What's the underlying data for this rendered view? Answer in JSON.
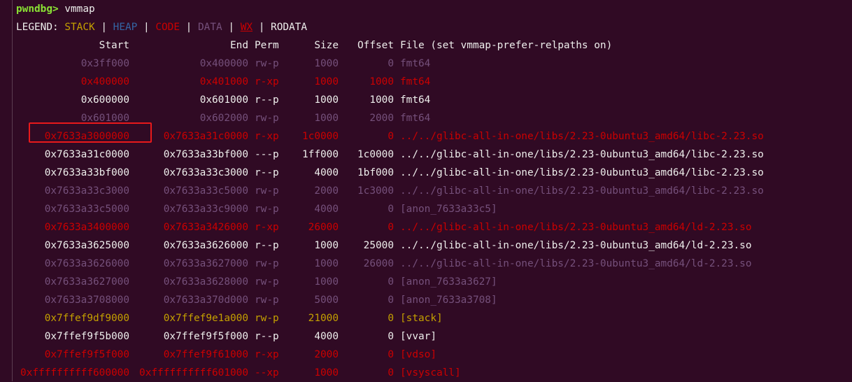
{
  "prompt": {
    "name": "pwndbg>",
    "command": "vmmap"
  },
  "legend": {
    "label": "LEGEND:",
    "separator": "|",
    "items": [
      {
        "text": "STACK",
        "kind": "stack"
      },
      {
        "text": "HEAP",
        "kind": "heap"
      },
      {
        "text": "CODE",
        "kind": "code"
      },
      {
        "text": "DATA",
        "kind": "data"
      },
      {
        "text": "WX",
        "kind": "wx"
      },
      {
        "text": "RODATA",
        "kind": "rodata"
      }
    ]
  },
  "table": {
    "headers": [
      "Start",
      "End",
      "Perm",
      "Size",
      "Offset",
      "File (set vmmap-prefer-relpaths on)"
    ],
    "rows": [
      {
        "start": "0x3ff000",
        "end": "0x400000",
        "perm": "rw-p",
        "size": "1000",
        "offset": "0",
        "file": "fmt64",
        "kind": "data"
      },
      {
        "start": "0x400000",
        "end": "0x401000",
        "perm": "r-xp",
        "size": "1000",
        "offset": "1000",
        "file": "fmt64",
        "kind": "code"
      },
      {
        "start": "0x600000",
        "end": "0x601000",
        "perm": "r--p",
        "size": "1000",
        "offset": "1000",
        "file": "fmt64",
        "kind": "rodata"
      },
      {
        "start": "0x601000",
        "end": "0x602000",
        "perm": "rw-p",
        "size": "1000",
        "offset": "2000",
        "file": "fmt64",
        "kind": "data"
      },
      {
        "start": "0x7633a3000000",
        "end": "0x7633a31c0000",
        "perm": "r-xp",
        "size": "1c0000",
        "offset": "0",
        "file": "../../glibc-all-in-one/libs/2.23-0ubuntu3_amd64/libc-2.23.so",
        "kind": "code"
      },
      {
        "start": "0x7633a31c0000",
        "end": "0x7633a33bf000",
        "perm": "---p",
        "size": "1ff000",
        "offset": "1c0000",
        "file": "../../glibc-all-in-one/libs/2.23-0ubuntu3_amd64/libc-2.23.so",
        "kind": "rodata"
      },
      {
        "start": "0x7633a33bf000",
        "end": "0x7633a33c3000",
        "perm": "r--p",
        "size": "4000",
        "offset": "1bf000",
        "file": "../../glibc-all-in-one/libs/2.23-0ubuntu3_amd64/libc-2.23.so",
        "kind": "rodata"
      },
      {
        "start": "0x7633a33c3000",
        "end": "0x7633a33c5000",
        "perm": "rw-p",
        "size": "2000",
        "offset": "1c3000",
        "file": "../../glibc-all-in-one/libs/2.23-0ubuntu3_amd64/libc-2.23.so",
        "kind": "data"
      },
      {
        "start": "0x7633a33c5000",
        "end": "0x7633a33c9000",
        "perm": "rw-p",
        "size": "4000",
        "offset": "0",
        "file": "[anon_7633a33c5]",
        "kind": "data"
      },
      {
        "start": "0x7633a3400000",
        "end": "0x7633a3426000",
        "perm": "r-xp",
        "size": "26000",
        "offset": "0",
        "file": "../../glibc-all-in-one/libs/2.23-0ubuntu3_amd64/ld-2.23.so",
        "kind": "code"
      },
      {
        "start": "0x7633a3625000",
        "end": "0x7633a3626000",
        "perm": "r--p",
        "size": "1000",
        "offset": "25000",
        "file": "../../glibc-all-in-one/libs/2.23-0ubuntu3_amd64/ld-2.23.so",
        "kind": "rodata"
      },
      {
        "start": "0x7633a3626000",
        "end": "0x7633a3627000",
        "perm": "rw-p",
        "size": "1000",
        "offset": "26000",
        "file": "../../glibc-all-in-one/libs/2.23-0ubuntu3_amd64/ld-2.23.so",
        "kind": "data"
      },
      {
        "start": "0x7633a3627000",
        "end": "0x7633a3628000",
        "perm": "rw-p",
        "size": "1000",
        "offset": "0",
        "file": "[anon_7633a3627]",
        "kind": "data"
      },
      {
        "start": "0x7633a3708000",
        "end": "0x7633a370d000",
        "perm": "rw-p",
        "size": "5000",
        "offset": "0",
        "file": "[anon_7633a3708]",
        "kind": "data"
      },
      {
        "start": "0x7ffef9df9000",
        "end": "0x7ffef9e1a000",
        "perm": "rw-p",
        "size": "21000",
        "offset": "0",
        "file": "[stack]",
        "kind": "stack"
      },
      {
        "start": "0x7ffef9f5b000",
        "end": "0x7ffef9f5f000",
        "perm": "r--p",
        "size": "4000",
        "offset": "0",
        "file": "[vvar]",
        "kind": "rodata"
      },
      {
        "start": "0x7ffef9f5f000",
        "end": "0x7ffef9f61000",
        "perm": "r-xp",
        "size": "2000",
        "offset": "0",
        "file": "[vdso]",
        "kind": "code"
      },
      {
        "start": "0xffffffffff600000",
        "end": "0xffffffffff601000",
        "perm": "--xp",
        "size": "1000",
        "offset": "0",
        "file": "[vsyscall]",
        "kind": "code"
      }
    ]
  },
  "colors": {
    "background": "#300a24",
    "stack": "#c4a000",
    "heap": "#3465a4",
    "code": "#cc0000",
    "data": "#75507b",
    "wx": "#cc0000",
    "rodata": "#eeeeec",
    "prompt": "#8ae234",
    "highlight_box": "#e8191b"
  }
}
